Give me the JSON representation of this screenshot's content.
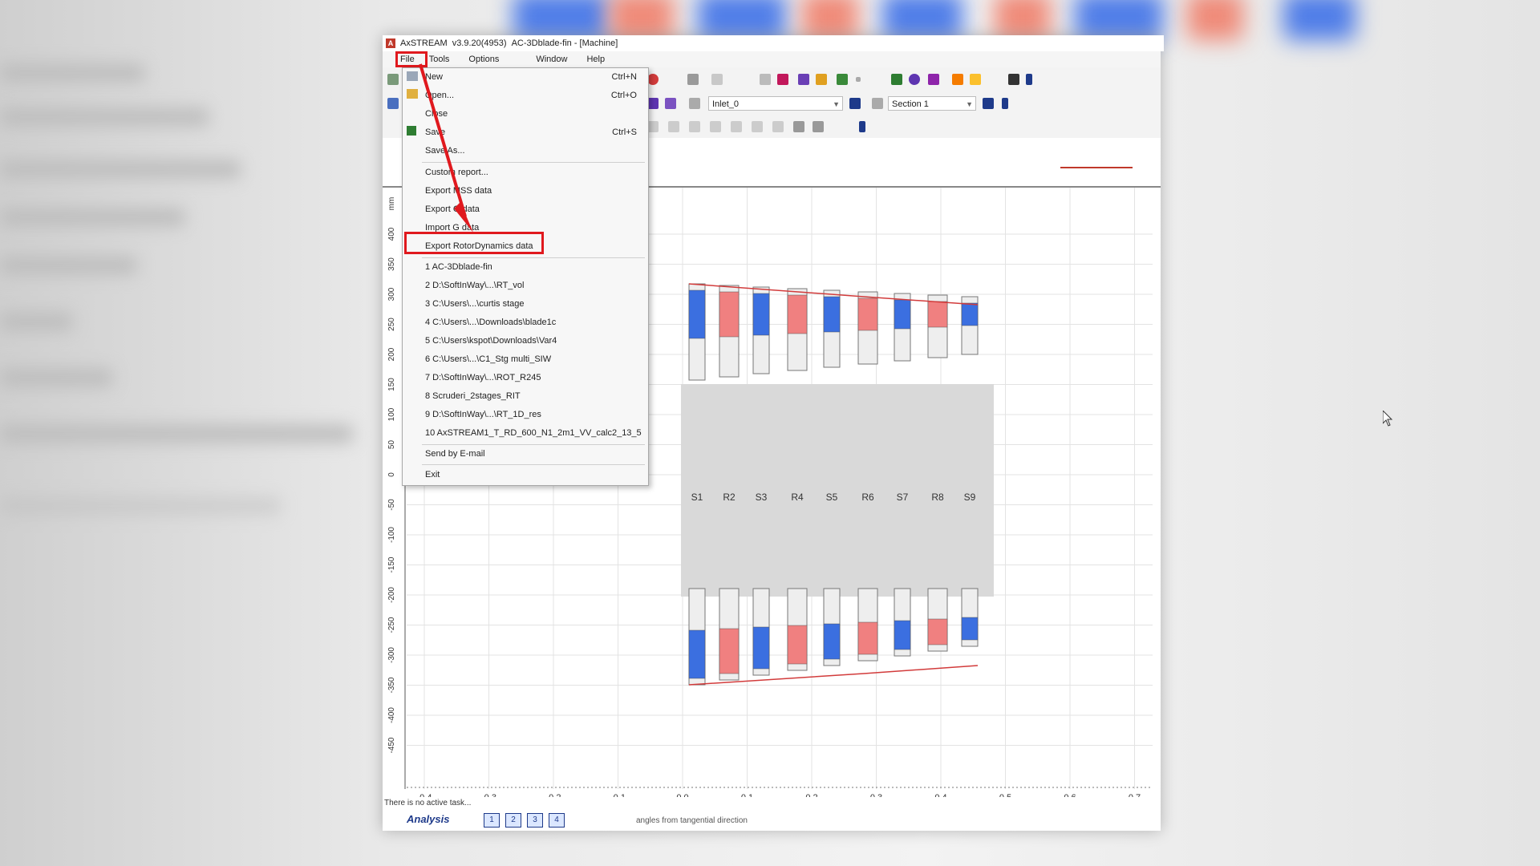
{
  "window": {
    "title_app": "AxSTREAM",
    "title_version": "v3.9.20(4953)",
    "title_doc": "AC-3Dblade-fin - [Machine]"
  },
  "menubar": [
    "File",
    "Tools",
    "Options",
    "Window",
    "Help"
  ],
  "toolbar": {
    "inlet_combo": "Inlet_0",
    "section_combo": "Section 1"
  },
  "file_menu": {
    "items": [
      {
        "label": "New",
        "shortcut": "Ctrl+N"
      },
      {
        "label": "Open...",
        "shortcut": "Ctrl+O"
      },
      {
        "label": "Close",
        "shortcut": ""
      },
      {
        "label": "Save",
        "shortcut": "Ctrl+S"
      },
      {
        "label": "Save As...",
        "shortcut": ""
      },
      {
        "label": "Custom report...",
        "shortcut": ""
      },
      {
        "label": "Export MSS data",
        "shortcut": ""
      },
      {
        "label": "Export G data",
        "shortcut": ""
      },
      {
        "label": "Import G data",
        "shortcut": ""
      },
      {
        "label": "Export RotorDynamics data",
        "shortcut": ""
      }
    ],
    "recent": [
      "1 AC-3Dblade-fin",
      "2 D:\\SoftInWay\\...\\RT_vol",
      "3 C:\\Users\\...\\curtis stage",
      "4 C:\\Users\\...\\Downloads\\blade1c",
      "5 C:\\Users\\kspot\\Downloads\\Var4",
      "6 C:\\Users\\...\\C1_Stg multi_SIW",
      "7 D:\\SoftInWay\\...\\ROT_R245",
      "8 Scruderi_2stages_RIT",
      "9 D:\\SoftInWay\\...\\RT_1D_res",
      "10 AxSTREAM1_T_RD_600_N1_2m1_VV_calc2_13_5"
    ],
    "send": "Send by E-mail",
    "exit": "Exit"
  },
  "plot": {
    "x_ticks": [
      "-0.4",
      "-0.3",
      "-0.2",
      "-0.1",
      "0.0",
      "0.1",
      "0.2",
      "0.3",
      "0.4",
      "0.5",
      "0.6",
      "0.7"
    ],
    "y_ticks": [
      "400",
      "350",
      "300",
      "250",
      "200",
      "150",
      "100",
      "50",
      "0",
      "-50",
      "-100",
      "-150",
      "-200",
      "-250",
      "-300",
      "-350",
      "-400",
      "-450"
    ],
    "y_unit": "mm",
    "stage_labels": [
      "S1",
      "R2",
      "S3",
      "R4",
      "S5",
      "R6",
      "S7",
      "R8",
      "S9"
    ],
    "stator_color": "#3b6fe0",
    "rotor_color": "#f08080"
  },
  "status": {
    "task": "There is no active task...",
    "mode": "Analysis",
    "pages": [
      "1",
      "2",
      "3",
      "4"
    ],
    "hint": "angles from tangential direction"
  }
}
